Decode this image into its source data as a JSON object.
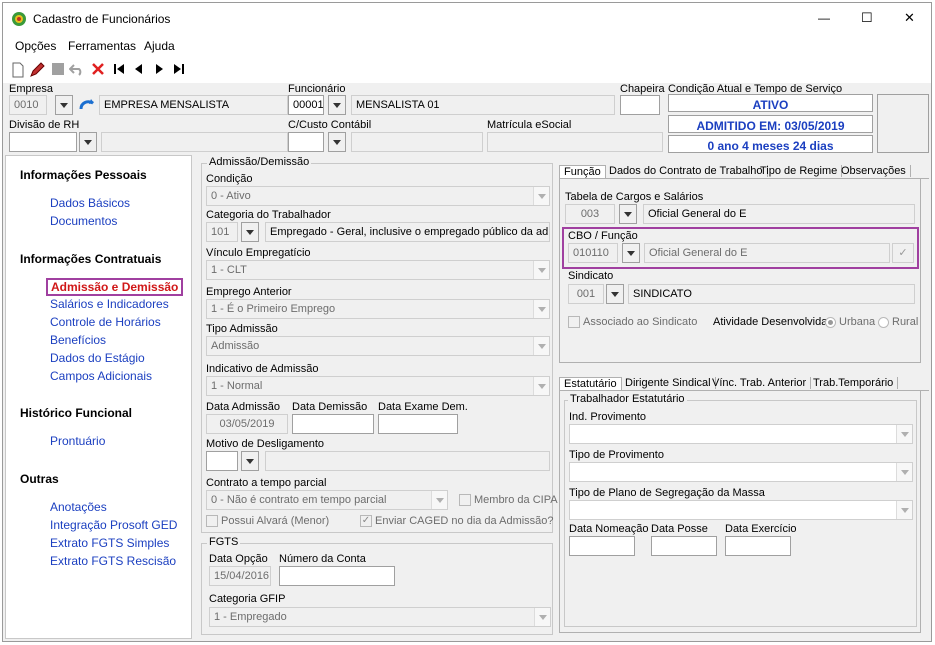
{
  "window": {
    "title": "Cadastro de Funcionários",
    "minimize": "—",
    "maximize": "☐",
    "close": "✕"
  },
  "menu": {
    "options": "Opções",
    "tools": "Ferramentas",
    "help": "Ajuda"
  },
  "header": {
    "empresa_label": "Empresa",
    "empresa_code": "0010",
    "empresa_name": "EMPRESA MENSALISTA",
    "funcionario_label": "Funcionário",
    "funcionario_code": "00001",
    "funcionario_name": "MENSALISTA 01",
    "chapeira_label": "Chapeira",
    "condicao_label": "Condição Atual e Tempo de Serviço",
    "status": "ATIVO",
    "admitido": "ADMITIDO EM: 03/05/2019",
    "tempo": "0 ano 4 meses 24 dias",
    "divisao_label": "Divisão de RH",
    "custo_label": "C/Custo Contábil",
    "matricula_label": "Matrícula eSocial"
  },
  "sidebar": {
    "pessoais": "Informações Pessoais",
    "dados_basicos": "Dados Básicos",
    "documentos": "Documentos",
    "contratuais": "Informações Contratuais",
    "admissao": "Admissão e Demissão",
    "salarios": "Salários e Indicadores",
    "horarios": "Controle de Horários",
    "beneficios": "Benefícios",
    "estagio": "Dados do Estágio",
    "campos": "Campos Adicionais",
    "historico": "Histórico Funcional",
    "prontuario": "Prontuário",
    "outras": "Outras",
    "anotacoes": "Anotações",
    "prosoft": "Integração Prosoft GED",
    "fgts_simples": "Extrato FGTS Simples",
    "fgts_rescisao": "Extrato FGTS Rescisão"
  },
  "admissao": {
    "group": "Admissão/Demissão",
    "condicao_label": "Condição",
    "condicao": "0 - Ativo",
    "categoria_label": "Categoria do Trabalhador",
    "categoria_code": "101",
    "categoria_text": "Empregado - Geral, inclusive o empregado público da administ",
    "vinculo_label": "Vínculo Empregatício",
    "vinculo": "1 - CLT",
    "anterior_label": "Emprego Anterior",
    "anterior": "1 - É o Primeiro Emprego",
    "tipo_label": "Tipo Admissão",
    "tipo": "Admissão",
    "indicativo_label": "Indicativo de Admissão",
    "indicativo": "1 - Normal",
    "data_adm_label": "Data Admissão",
    "data_adm": "03/05/2019",
    "data_dem_label": "Data Demissão",
    "data_exame_label": "Data Exame Dem.",
    "motivo_label": "Motivo de Desligamento",
    "parcial_label": "Contrato a tempo parcial",
    "parcial": "0 - Não é contrato em tempo parcial",
    "membro_cipa": "Membro da CIPA",
    "alvara": "Possui Alvará (Menor)",
    "caged": "Enviar CAGED no dia da Admissão?"
  },
  "fgts": {
    "group": "FGTS",
    "data_opcao_label": "Data Opção",
    "data_opcao": "15/04/2016",
    "conta_label": "Número da Conta",
    "gfip_label": "Categoria GFIP",
    "gfip": "1 - Empregado"
  },
  "tabs1": {
    "funcao": "Função",
    "contrato": "Dados do Contrato de Trabalho",
    "regime": "Tipo de Regime",
    "obs": "Observações"
  },
  "funcao": {
    "tabela_label": "Tabela de Cargos e Salários",
    "tabela_code": "003",
    "tabela_text": "Oficial General do E",
    "cbo_label": "CBO / Função",
    "cbo_code": "010110",
    "cbo_text": "Oficial General do E",
    "sindicato_label": "Sindicato",
    "sindicato_code": "001",
    "sindicato_text": "SINDICATO",
    "associado": "Associado ao Sindicato",
    "atividade_label": "Atividade Desenvolvida:",
    "urbana": "Urbana",
    "rural": "Rural"
  },
  "tabs2": {
    "estatutario": "Estatutário",
    "dirigente": "Dirigente Sindical",
    "vinc": "Vínc. Trab. Anterior",
    "temporario": "Trab.Temporário"
  },
  "estatutario": {
    "group": "Trabalhador Estatutário",
    "ind_label": "Ind. Provimento",
    "tipo_label": "Tipo de Provimento",
    "plano_label": "Tipo de Plano de Segregação da Massa",
    "nomeacao_label": "Data Nomeação",
    "posse_label": "Data Posse",
    "exercicio_label": "Data Exercício"
  }
}
